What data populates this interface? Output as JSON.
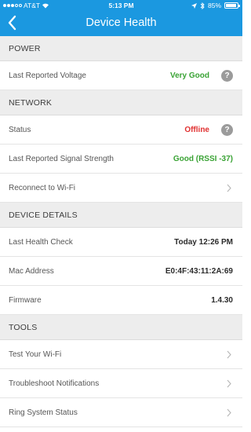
{
  "status_bar": {
    "carrier": "AT&T",
    "time": "5:13 PM",
    "battery": "85%",
    "battery_level": 0.85
  },
  "header": {
    "title": "Device Health"
  },
  "sections": {
    "power": {
      "title": "POWER",
      "voltage": {
        "label": "Last Reported Voltage",
        "value": "Very Good"
      }
    },
    "network": {
      "title": "NETWORK",
      "status": {
        "label": "Status",
        "value": "Offline"
      },
      "signal": {
        "label": "Last Reported Signal Strength",
        "value": "Good (RSSI -37)"
      },
      "reconnect": {
        "label": "Reconnect to Wi-Fi"
      }
    },
    "details": {
      "title": "DEVICE DETAILS",
      "health_check": {
        "label": "Last Health Check",
        "value": "Today 12:26 PM"
      },
      "mac": {
        "label": "Mac Address",
        "value": "E0:4F:43:11:2A:69"
      },
      "firmware": {
        "label": "Firmware",
        "value": "1.4.30"
      }
    },
    "tools": {
      "title": "TOOLS",
      "test_wifi": {
        "label": "Test Your Wi-Fi"
      },
      "troubleshoot": {
        "label": "Troubleshoot Notifications"
      },
      "system_status": {
        "label": "Ring System Status"
      }
    }
  },
  "icons": {
    "help": "?"
  },
  "colors": {
    "header": "#1b98e0",
    "good": "#3aa335",
    "bad": "#e03131"
  }
}
